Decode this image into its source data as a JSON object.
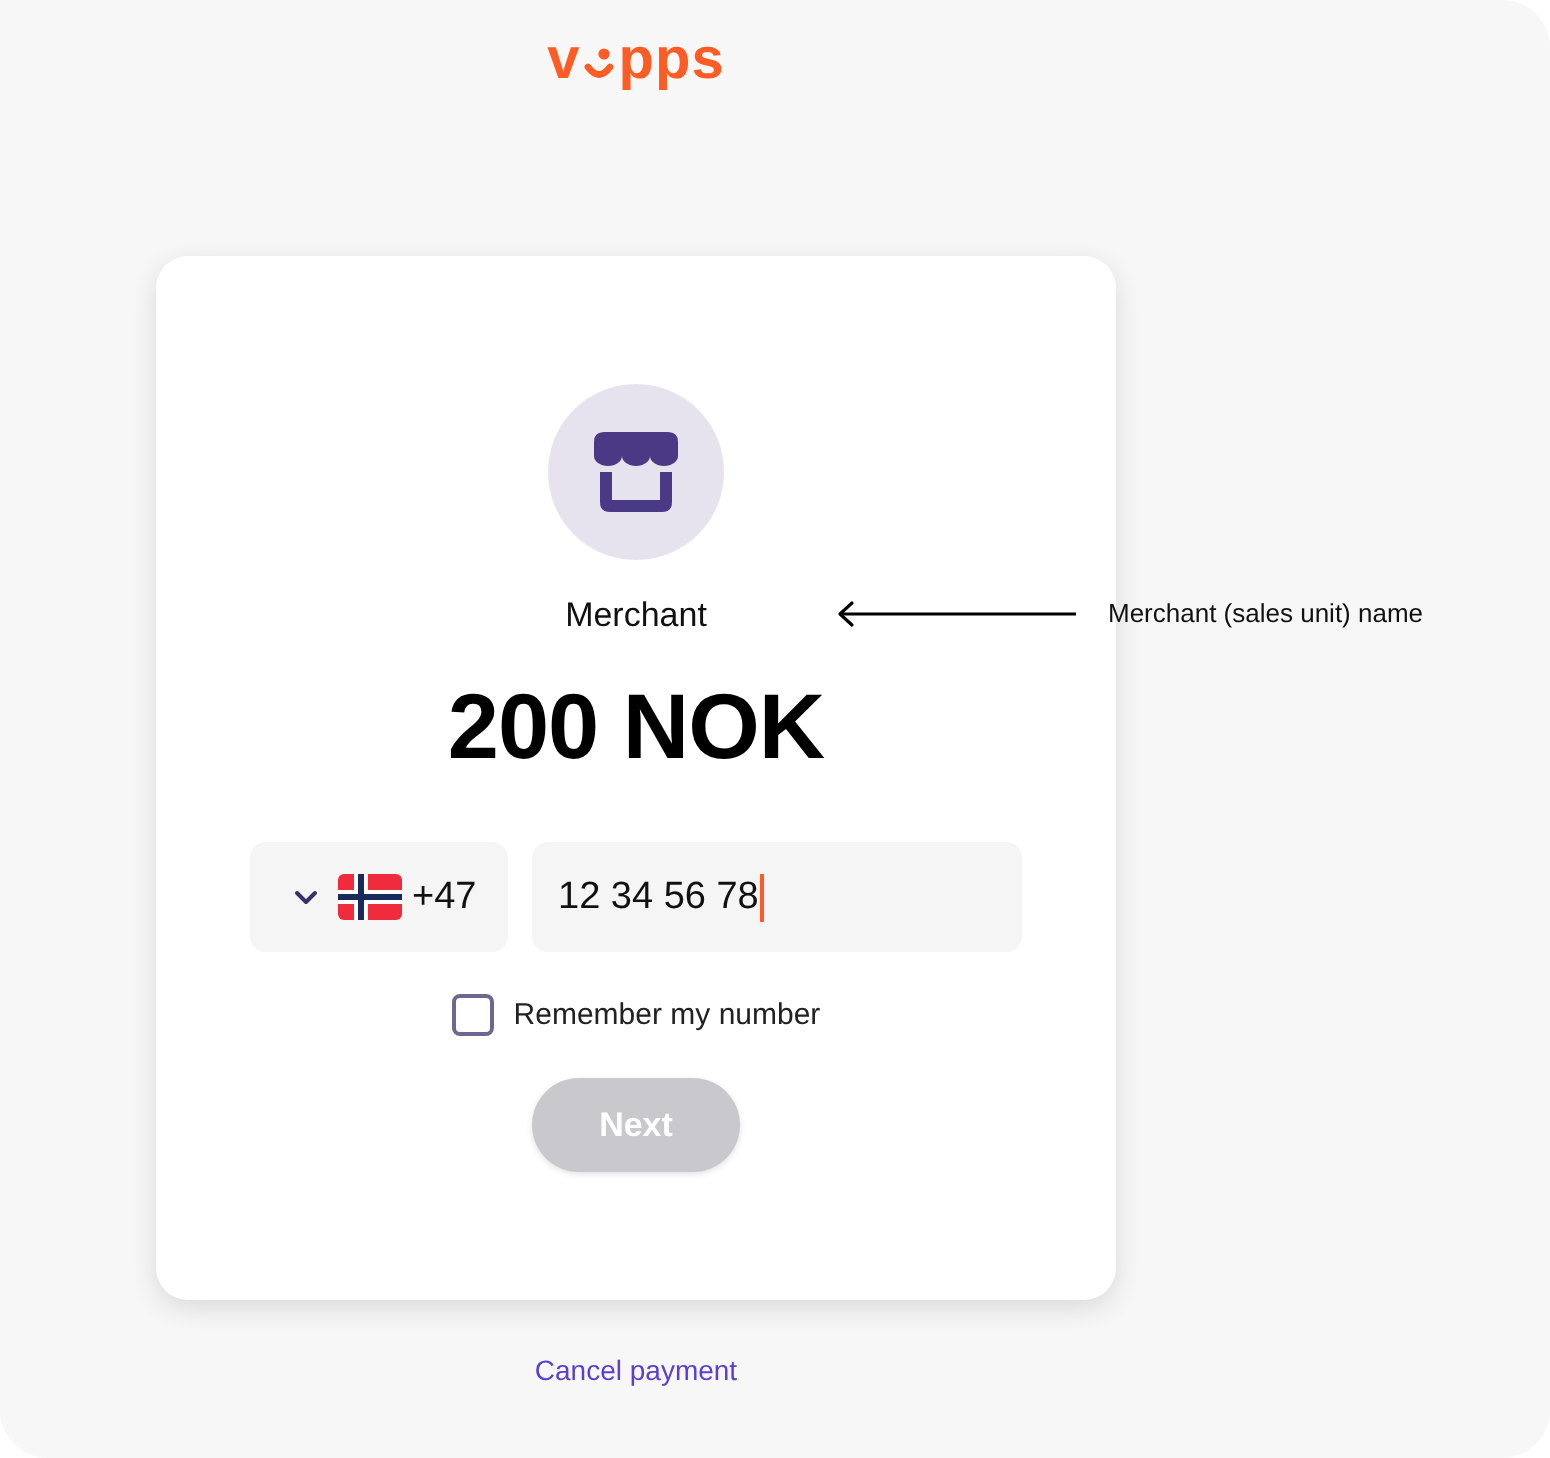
{
  "logo": {
    "text_start": "v",
    "text_end": "pps"
  },
  "merchant": {
    "name": "Merchant"
  },
  "amount": "200 NOK",
  "phone": {
    "country_code": "+47",
    "number": "12 34 56 78",
    "focused": true
  },
  "remember": {
    "label": "Remember my number",
    "checked": false
  },
  "next_button": {
    "label": "Next",
    "disabled": true
  },
  "cancel_link": "Cancel payment",
  "annotation": {
    "text": "Merchant (sales unit) name"
  }
}
